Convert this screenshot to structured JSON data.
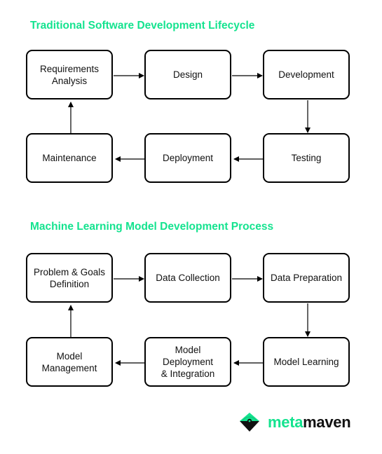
{
  "diagrams": [
    {
      "title": "Traditional Software Development Lifecycle",
      "steps": [
        {
          "lines": [
            "Requirements",
            "Analysis"
          ]
        },
        {
          "lines": [
            "Design"
          ]
        },
        {
          "lines": [
            "Development"
          ]
        },
        {
          "lines": [
            "Testing"
          ]
        },
        {
          "lines": [
            "Deployment"
          ]
        },
        {
          "lines": [
            "Maintenance"
          ]
        }
      ]
    },
    {
      "title": "Machine Learning Model Development Process",
      "steps": [
        {
          "lines": [
            "Problem & Goals",
            "Definition"
          ]
        },
        {
          "lines": [
            "Data Collection"
          ]
        },
        {
          "lines": [
            "Data Preparation"
          ]
        },
        {
          "lines": [
            "Model Learning"
          ]
        },
        {
          "lines": [
            "Model Deployment",
            "& Integration"
          ]
        },
        {
          "lines": [
            "Model",
            "Management"
          ]
        }
      ]
    }
  ],
  "flow": "1 → 2 → 3 ↓ 4 ← 5 ← 6 ↑ 1",
  "logo": {
    "part1": "meta",
    "part2": "maven",
    "icon": "diamond-eye-icon"
  },
  "colors": {
    "accent": "#14e38f",
    "stroke": "#000000",
    "text": "#111111"
  }
}
